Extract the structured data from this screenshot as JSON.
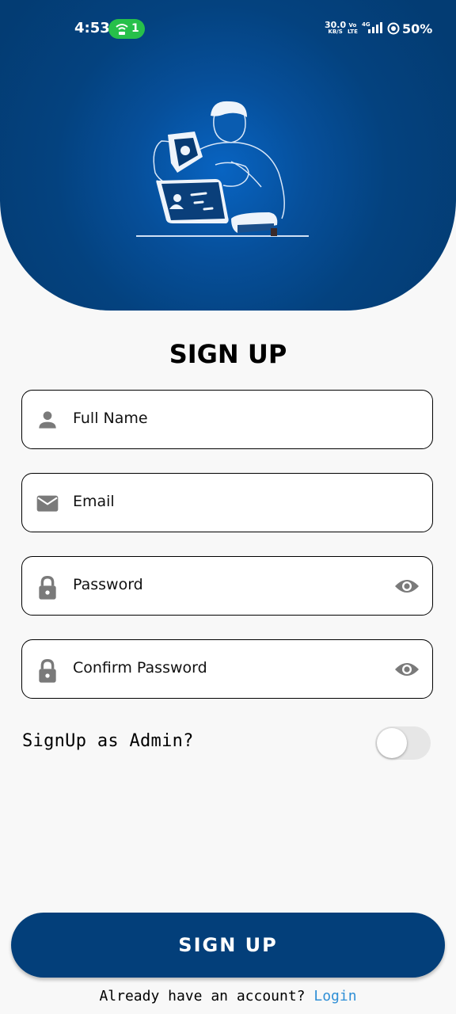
{
  "status_bar": {
    "time": "4:53",
    "hotspot_count": "1",
    "net_speed_value": "30.0",
    "net_speed_unit": "KB/S",
    "volte_top": "Vo",
    "volte_bottom": "LTE",
    "network_type": "4G",
    "battery": "50%"
  },
  "page": {
    "title": "SIGN UP"
  },
  "form": {
    "full_name_placeholder": "Full Name",
    "email_placeholder": "Email",
    "password_placeholder": "Password",
    "confirm_password_placeholder": "Confirm Password",
    "admin_toggle_label": "SignUp as Admin?",
    "admin_toggle_on": false
  },
  "actions": {
    "signup_label": "SIGN UP",
    "footer_text": "Already have an account?",
    "login_label": "Login"
  },
  "colors": {
    "primary": "#033f7a",
    "link": "#2f8fd6",
    "hotspot": "#27c04a"
  }
}
